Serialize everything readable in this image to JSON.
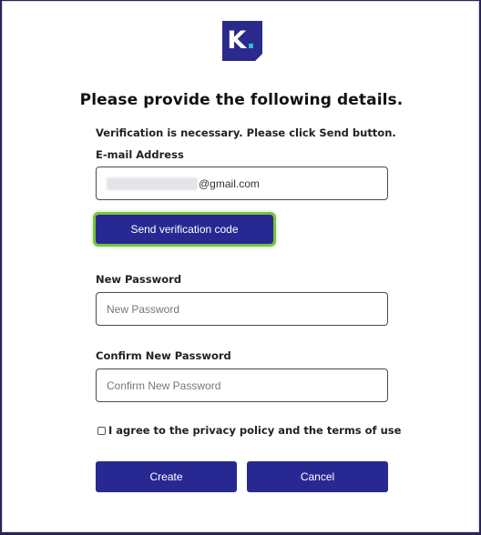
{
  "logo": {
    "letter": "K",
    "dot": "."
  },
  "title": "Please provide the following details.",
  "verification_note": "Verification is necessary. Please click Send button.",
  "email": {
    "label": "E-mail Address",
    "value_suffix": "@gmail.com"
  },
  "send_button": {
    "label": "Send verification code"
  },
  "new_password": {
    "label": "New Password",
    "placeholder": "New Password"
  },
  "confirm_password": {
    "label": "Confirm New Password",
    "placeholder": "Confirm New Password"
  },
  "agreement": {
    "label": "I agree to the privacy policy and the terms of use",
    "checked": false
  },
  "actions": {
    "create_label": "Create",
    "cancel_label": "Cancel"
  },
  "colors": {
    "primary": "#282893",
    "focus_ring": "#78c43a",
    "logo_accent": "#28c6d6",
    "background": "#2a2456"
  },
  "icons": {
    "logo": "k-logo-icon",
    "checkbox": "checkbox-icon"
  }
}
